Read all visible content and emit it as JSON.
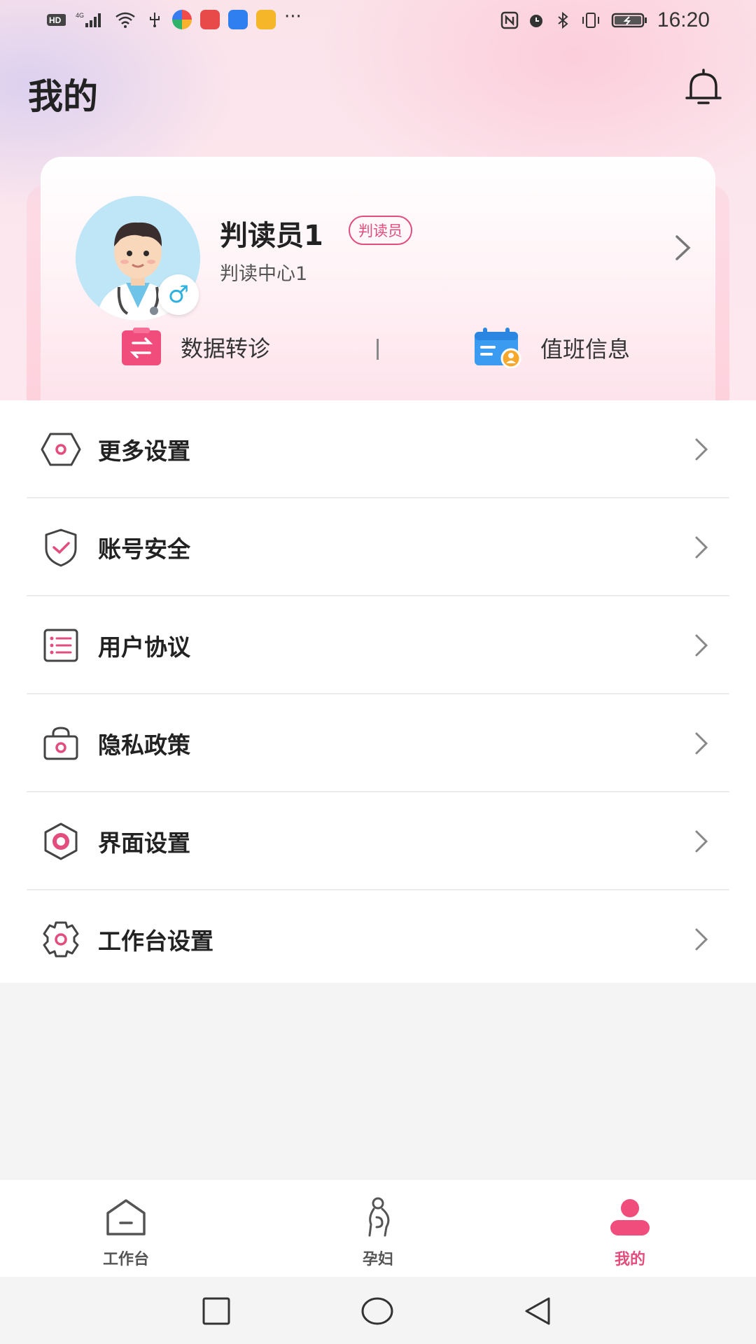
{
  "status_bar": {
    "time": "16:20",
    "left_icons": [
      "hd-icon",
      "signal-4g-icon",
      "wifi-icon",
      "usb-icon",
      "app-icon",
      "book-app-icon",
      "weather-app-icon",
      "folder-app-icon",
      "more-dots-icon"
    ],
    "right_icons": [
      "nfc-icon",
      "alarm-icon",
      "bluetooth-icon",
      "vibrate-icon",
      "battery-charging-icon"
    ]
  },
  "header": {
    "title": "我的",
    "bell_icon": "bell-icon"
  },
  "profile": {
    "name": "判读员1",
    "role": "判读员",
    "org": "判读中心1",
    "gender_symbol": "♂",
    "chevron_icon": "chevron-right-icon",
    "actions": [
      {
        "label": "数据转诊",
        "icon": "transfer-icon",
        "color": "#f04c7c"
      },
      {
        "label": "值班信息",
        "icon": "calendar-user-icon",
        "color": "#3a9bf0"
      }
    ]
  },
  "menu": {
    "items": [
      {
        "label": "更多设置",
        "icon": "hexagon-settings-icon"
      },
      {
        "label": "账号安全",
        "icon": "shield-check-icon"
      },
      {
        "label": "用户协议",
        "icon": "list-document-icon"
      },
      {
        "label": "隐私政策",
        "icon": "lock-bag-icon"
      },
      {
        "label": "界面设置",
        "icon": "hexagon-ring-icon"
      },
      {
        "label": "工作台设置",
        "icon": "gear-icon"
      }
    ]
  },
  "bottom_nav": {
    "items": [
      {
        "label": "工作台",
        "icon": "home-icon",
        "active": false
      },
      {
        "label": "孕妇",
        "icon": "pregnant-icon",
        "active": false
      },
      {
        "label": "我的",
        "icon": "user-icon",
        "active": true
      }
    ]
  },
  "colors": {
    "accent": "#e24d7d",
    "blue": "#3a9bf0",
    "text": "#222222"
  }
}
